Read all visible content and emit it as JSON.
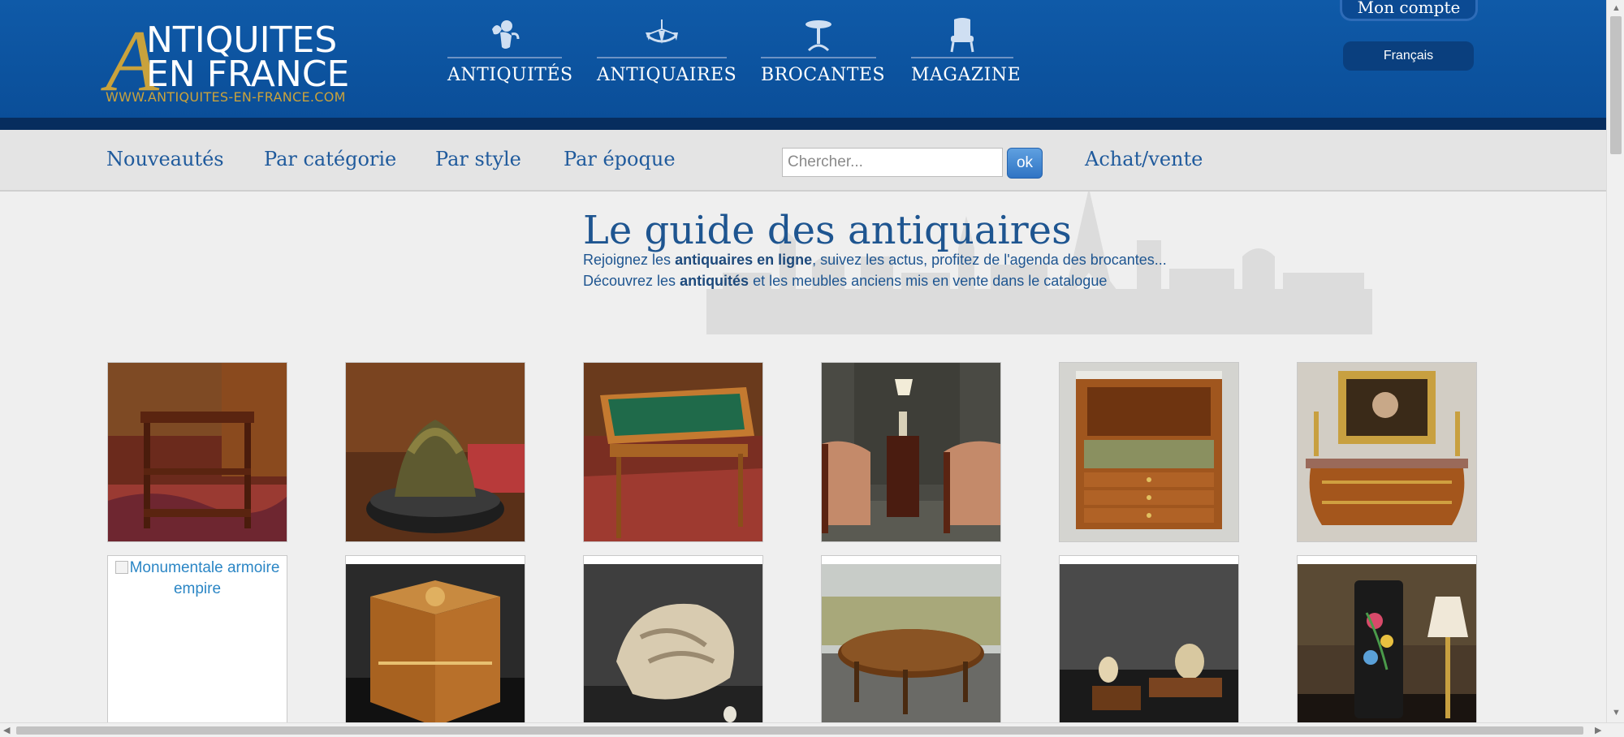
{
  "header": {
    "logo": {
      "big_letter": "A",
      "line1": "NTIQUITES",
      "line2": "EN FRANCE",
      "url": "WWW.ANTIQUITES-EN-FRANCE.COM"
    },
    "nav": [
      {
        "label": "ANTIQUITÉS",
        "icon": "cherub-icon"
      },
      {
        "label": "ANTIQUAIRES",
        "icon": "chandelier-icon"
      },
      {
        "label": "BROCANTES",
        "icon": "pedestal-table-icon"
      },
      {
        "label": "MAGAZINE",
        "icon": "armchair-icon"
      }
    ],
    "account_label": "Mon compte",
    "language_label": "Français"
  },
  "subnav": {
    "links": [
      "Nouveautés",
      "Par catégorie",
      "Par style",
      "Par époque"
    ],
    "search_placeholder": "Chercher...",
    "search_button": "ok",
    "buy_sell": "Achat/vente"
  },
  "hero": {
    "title": "Le guide des antiquaires",
    "line1_before": "Rejoignez les ",
    "line1_bold": "antiquaires en ligne",
    "line1_after": ", suivez les actus, profitez de l'agenda des brocantes...",
    "line2_before": "Découvrez les ",
    "line2_bold": "antiquités",
    "line2_after": " et les meubles anciens mis en vente dans le catalogue"
  },
  "products": {
    "row1": [
      {
        "name": "product-servant-table"
      },
      {
        "name": "product-bronze-sculpture"
      },
      {
        "name": "product-writing-desk"
      },
      {
        "name": "product-armchairs-pair"
      },
      {
        "name": "product-secretary-desk"
      },
      {
        "name": "product-commode"
      }
    ],
    "row2": [
      {
        "alt": "Monumentale armoire empire",
        "broken": true
      },
      {
        "name": "product-marquetry-box"
      },
      {
        "name": "product-shell-sculpture"
      },
      {
        "name": "product-round-table"
      },
      {
        "name": "product-bookends"
      },
      {
        "name": "product-painted-vase"
      }
    ]
  },
  "colors": {
    "header_blue": "#0a4d97",
    "gold": "#c9a23c",
    "link_blue": "#1f5a9c"
  }
}
